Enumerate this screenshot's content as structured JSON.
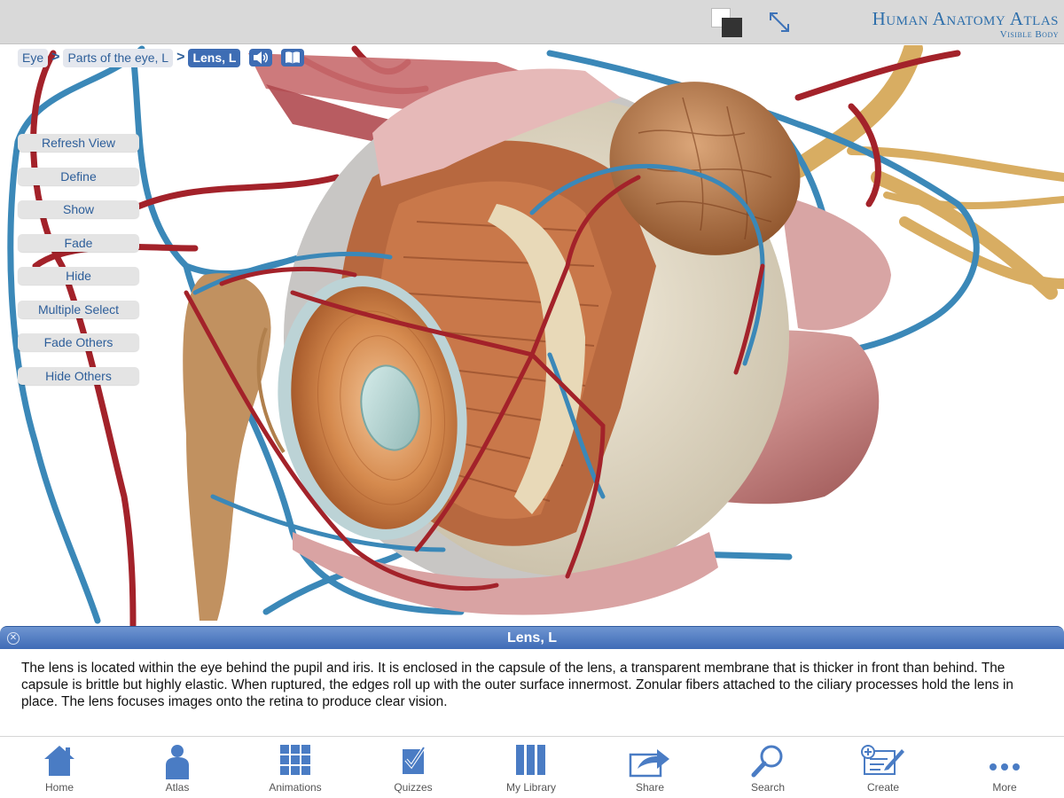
{
  "app": {
    "title": "Human Anatomy Atlas",
    "subtitle": "Visible Body"
  },
  "breadcrumb": {
    "items": [
      "Eye",
      "Parts of the eye, L",
      "Lens, L"
    ],
    "separator": ">"
  },
  "side_menu": {
    "buttons": [
      "Refresh View",
      "Define",
      "Show",
      "Fade",
      "Hide",
      "Multiple Select",
      "Fade Others",
      "Hide Others"
    ]
  },
  "info_panel": {
    "title": "Lens, L",
    "description": "The lens is located within the eye behind the pupil and iris. It is enclosed in the capsule of the lens, a transparent membrane that is thicker in front than behind. The capsule is brittle but highly elastic. When ruptured, the edges roll up with the outer surface innermost. Zonular fibers attached to the ciliary processes hold the lens in place. The lens focuses images onto the retina to produce clear vision."
  },
  "toolbar": {
    "items": [
      {
        "label": "Home",
        "icon": "home-icon"
      },
      {
        "label": "Atlas",
        "icon": "person-icon"
      },
      {
        "label": "Animations",
        "icon": "grid-icon"
      },
      {
        "label": "Quizzes",
        "icon": "checkbox-icon"
      },
      {
        "label": "My Library",
        "icon": "library-icon"
      },
      {
        "label": "Share",
        "icon": "share-icon"
      },
      {
        "label": "Search",
        "icon": "search-icon"
      },
      {
        "label": "Create",
        "icon": "create-icon"
      },
      {
        "label": "More",
        "icon": "more-icon"
      }
    ]
  },
  "colors": {
    "accent": "#3e6db4",
    "icon_blue": "#4a7cc4",
    "topbar": "#d9d9d9",
    "vein_blue": "#3b88b8",
    "artery_red": "#a3222a"
  }
}
